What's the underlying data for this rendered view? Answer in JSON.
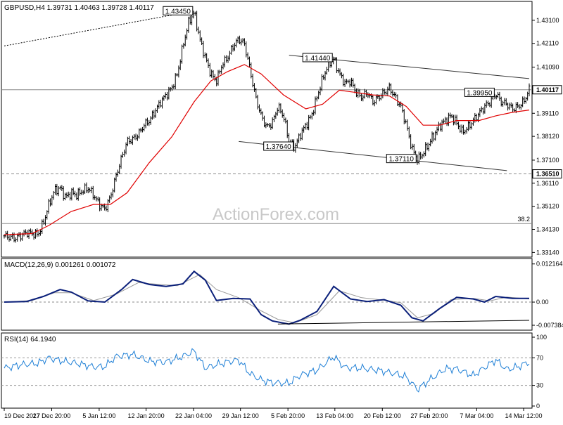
{
  "chart_data": [
    {
      "type": "line",
      "title": "GBPUSD,H4",
      "ohlc": {
        "open": "1.39731",
        "high": "1.40463",
        "low": "1.39728",
        "close": "1.40117"
      },
      "yticks": [
        "1.43100",
        "1.42110",
        "1.41090",
        "1.40100",
        "1.39110",
        "1.38120",
        "1.37100",
        "1.36110",
        "1.35120",
        "1.34130",
        "1.33140"
      ],
      "xticks": [
        "19 Dec 2017",
        "27 Dec 20:00",
        "5 Jan 12:00",
        "12 Jan 20:00",
        "22 Jan 04:00",
        "29 Jan 12:00",
        "5 Feb 20:00",
        "13 Feb 04:00",
        "20 Feb 12:00",
        "27 Feb 20:00",
        "7 Mar 04:00",
        "14 Mar 12:00"
      ],
      "ylim": [
        1.33,
        1.4385
      ],
      "price_path": [
        [
          0,
          1.3385
        ],
        [
          2,
          1.3375
        ],
        [
          4,
          1.34
        ],
        [
          6,
          1.339
        ],
        [
          7,
          1.344
        ],
        [
          8,
          1.352
        ],
        [
          9,
          1.358
        ],
        [
          10,
          1.359
        ],
        [
          11,
          1.355
        ],
        [
          12,
          1.357
        ],
        [
          13,
          1.356
        ],
        [
          14,
          1.358
        ],
        [
          15,
          1.359
        ],
        [
          16,
          1.356
        ],
        [
          17,
          1.352
        ],
        [
          18,
          1.35
        ],
        [
          19,
          1.355
        ],
        [
          20,
          1.364
        ],
        [
          21,
          1.372
        ],
        [
          22,
          1.379
        ],
        [
          23,
          1.38
        ],
        [
          24,
          1.382
        ],
        [
          25,
          1.386
        ],
        [
          26,
          1.388
        ],
        [
          27,
          1.392
        ],
        [
          28,
          1.396
        ],
        [
          29,
          1.399
        ],
        [
          30,
          1.402
        ],
        [
          31,
          1.408
        ],
        [
          32,
          1.42
        ],
        [
          33,
          1.43
        ],
        [
          34,
          1.4345
        ],
        [
          35,
          1.423
        ],
        [
          36,
          1.415
        ],
        [
          37,
          1.408
        ],
        [
          38,
          1.405
        ],
        [
          39,
          1.412
        ],
        [
          40,
          1.415
        ],
        [
          41,
          1.42
        ],
        [
          42,
          1.423
        ],
        [
          43,
          1.421
        ],
        [
          44,
          1.41
        ],
        [
          45,
          1.398
        ],
        [
          46,
          1.39
        ],
        [
          47,
          1.385
        ],
        [
          48,
          1.387
        ],
        [
          49,
          1.394
        ],
        [
          50,
          1.39
        ],
        [
          51,
          1.379
        ],
        [
          52,
          1.3764
        ],
        [
          53,
          1.382
        ],
        [
          54,
          1.386
        ],
        [
          55,
          1.39
        ],
        [
          56,
          1.398
        ],
        [
          57,
          1.406
        ],
        [
          58,
          1.412
        ],
        [
          59,
          1.4144
        ],
        [
          60,
          1.408
        ],
        [
          61,
          1.404
        ],
        [
          62,
          1.405
        ],
        [
          63,
          1.4
        ],
        [
          64,
          1.398
        ],
        [
          65,
          1.4
        ],
        [
          66,
          1.396
        ],
        [
          67,
          1.398
        ],
        [
          68,
          1.4
        ],
        [
          69,
          1.402
        ],
        [
          70,
          1.398
        ],
        [
          71,
          1.394
        ],
        [
          72,
          1.386
        ],
        [
          73,
          1.376
        ],
        [
          74,
          1.3711
        ],
        [
          75,
          1.374
        ],
        [
          76,
          1.378
        ],
        [
          77,
          1.382
        ],
        [
          78,
          1.386
        ],
        [
          79,
          1.388
        ],
        [
          80,
          1.39
        ],
        [
          81,
          1.387
        ],
        [
          82,
          1.383
        ],
        [
          83,
          1.385
        ],
        [
          84,
          1.388
        ],
        [
          85,
          1.391
        ],
        [
          86,
          1.394
        ],
        [
          87,
          1.396
        ],
        [
          88,
          1.3995
        ],
        [
          89,
          1.396
        ],
        [
          90,
          1.395
        ],
        [
          91,
          1.393
        ],
        [
          92,
          1.394
        ],
        [
          93,
          1.396
        ],
        [
          94,
          1.4012
        ]
      ],
      "ma_path": [
        [
          0,
          1.339
        ],
        [
          5,
          1.3395
        ],
        [
          8,
          1.343
        ],
        [
          12,
          1.349
        ],
        [
          16,
          1.352
        ],
        [
          19,
          1.352
        ],
        [
          22,
          1.357
        ],
        [
          26,
          1.37
        ],
        [
          30,
          1.381
        ],
        [
          34,
          1.396
        ],
        [
          37,
          1.405
        ],
        [
          40,
          1.409
        ],
        [
          43,
          1.412
        ],
        [
          46,
          1.408
        ],
        [
          50,
          1.399
        ],
        [
          54,
          1.393
        ],
        [
          57,
          1.395
        ],
        [
          60,
          1.401
        ],
        [
          63,
          1.4
        ],
        [
          66,
          1.399
        ],
        [
          69,
          1.3985
        ],
        [
          72,
          1.394
        ],
        [
          75,
          1.386
        ],
        [
          78,
          1.386
        ],
        [
          81,
          1.388
        ],
        [
          85,
          1.388
        ],
        [
          88,
          1.39
        ],
        [
          91,
          1.3915
        ],
        [
          94,
          1.3925
        ]
      ],
      "price_labels": [
        {
          "text": "1.43450",
          "x": 34,
          "y": 1.4345,
          "side": "left"
        },
        {
          "text": "1.41440",
          "x": 59,
          "y": 1.4144,
          "side": "left"
        },
        {
          "text": "1.37640",
          "x": 52,
          "y": 1.3764,
          "side": "left"
        },
        {
          "text": "1.37110",
          "x": 74,
          "y": 1.3711,
          "side": "left"
        },
        {
          "text": "1.39950",
          "x": 88,
          "y": 1.3995,
          "side": "left"
        }
      ],
      "horizontal_lines": [
        {
          "value": 1.4012,
          "style": "solid",
          "label": "1.40117"
        },
        {
          "value": 1.3651,
          "style": "dashed",
          "label": "1.36510"
        },
        {
          "value": 1.3438,
          "style": "solid",
          "label": "38.2"
        }
      ],
      "trend_lines": [
        {
          "x1": 51,
          "y1": 1.416,
          "x2": 94,
          "y2": 1.406
        },
        {
          "x1": 42,
          "y1": 1.379,
          "x2": 90,
          "y2": 1.3665
        }
      ],
      "sma200_path": [
        [
          0,
          1.42
        ],
        [
          34,
          1.435
        ]
      ],
      "watermark": "ActionForex.com"
    },
    {
      "type": "line",
      "title": "MACD(12,26,9) 0.001261 0.001072",
      "yticks": [
        "0.012164",
        "0.00",
        "-0.007384"
      ],
      "ylim": [
        -0.0085,
        0.013
      ],
      "macd": [
        [
          0,
          0.0
        ],
        [
          4,
          0.0002
        ],
        [
          7,
          0.0018
        ],
        [
          10,
          0.004
        ],
        [
          12,
          0.0032
        ],
        [
          15,
          0.0004
        ],
        [
          18,
          0.0
        ],
        [
          21,
          0.004
        ],
        [
          23,
          0.0072
        ],
        [
          26,
          0.0056
        ],
        [
          29,
          0.005
        ],
        [
          32,
          0.0058
        ],
        [
          34,
          0.0098
        ],
        [
          36,
          0.007
        ],
        [
          38,
          0.0005
        ],
        [
          41,
          0.0012
        ],
        [
          44,
          0.001
        ],
        [
          46,
          -0.004
        ],
        [
          48,
          -0.006
        ],
        [
          51,
          -0.007
        ],
        [
          53,
          -0.0058
        ],
        [
          56,
          -0.003
        ],
        [
          59,
          0.005
        ],
        [
          62,
          0.001
        ],
        [
          65,
          0.0002
        ],
        [
          68,
          0.0008
        ],
        [
          71,
          -0.001
        ],
        [
          73,
          -0.005
        ],
        [
          75,
          -0.006
        ],
        [
          78,
          -0.002
        ],
        [
          81,
          0.0015
        ],
        [
          84,
          0.001
        ],
        [
          86,
          0.0
        ],
        [
          88,
          0.0018
        ],
        [
          91,
          0.0012
        ],
        [
          94,
          0.0012
        ]
      ],
      "signal": [
        [
          0,
          0.0
        ],
        [
          5,
          0.0005
        ],
        [
          9,
          0.003
        ],
        [
          12,
          0.003
        ],
        [
          16,
          0.0005
        ],
        [
          20,
          0.0025
        ],
        [
          24,
          0.0062
        ],
        [
          28,
          0.0056
        ],
        [
          31,
          0.0052
        ],
        [
          35,
          0.0088
        ],
        [
          38,
          0.004
        ],
        [
          42,
          0.0014
        ],
        [
          46,
          -0.0028
        ],
        [
          49,
          -0.0055
        ],
        [
          52,
          -0.0066
        ],
        [
          56,
          -0.004
        ],
        [
          60,
          0.0036
        ],
        [
          64,
          0.0014
        ],
        [
          68,
          0.0006
        ],
        [
          71,
          -0.0002
        ],
        [
          74,
          -0.005
        ],
        [
          77,
          -0.0036
        ],
        [
          80,
          0.0008
        ],
        [
          84,
          0.0012
        ],
        [
          87,
          0.0004
        ],
        [
          90,
          0.0016
        ],
        [
          94,
          0.001
        ]
      ],
      "trend_line": {
        "x1": 49,
        "y1": -0.007,
        "x2": 94,
        "y2": -0.0058
      }
    },
    {
      "type": "line",
      "title": "RSI(14) 64.1940",
      "yticks": [
        "100",
        "70",
        "30",
        "0"
      ],
      "ylim": [
        0,
        100
      ],
      "rsi": [
        [
          0,
          55
        ],
        [
          3,
          60
        ],
        [
          6,
          62
        ],
        [
          8,
          70
        ],
        [
          10,
          66
        ],
        [
          13,
          62
        ],
        [
          16,
          57
        ],
        [
          18,
          57
        ],
        [
          20,
          72
        ],
        [
          23,
          75
        ],
        [
          26,
          65
        ],
        [
          29,
          64
        ],
        [
          32,
          72
        ],
        [
          34,
          80
        ],
        [
          36,
          55
        ],
        [
          38,
          60
        ],
        [
          40,
          64
        ],
        [
          42,
          67
        ],
        [
          44,
          47
        ],
        [
          46,
          38
        ],
        [
          48,
          34
        ],
        [
          51,
          33
        ],
        [
          53,
          45
        ],
        [
          56,
          52
        ],
        [
          59,
          72
        ],
        [
          61,
          56
        ],
        [
          64,
          55
        ],
        [
          67,
          52
        ],
        [
          70,
          47
        ],
        [
          72,
          42
        ],
        [
          74,
          24
        ],
        [
          76,
          37
        ],
        [
          79,
          54
        ],
        [
          81,
          54
        ],
        [
          84,
          44
        ],
        [
          86,
          56
        ],
        [
          88,
          67
        ],
        [
          90,
          53
        ],
        [
          92,
          57
        ],
        [
          94,
          64
        ]
      ]
    }
  ]
}
